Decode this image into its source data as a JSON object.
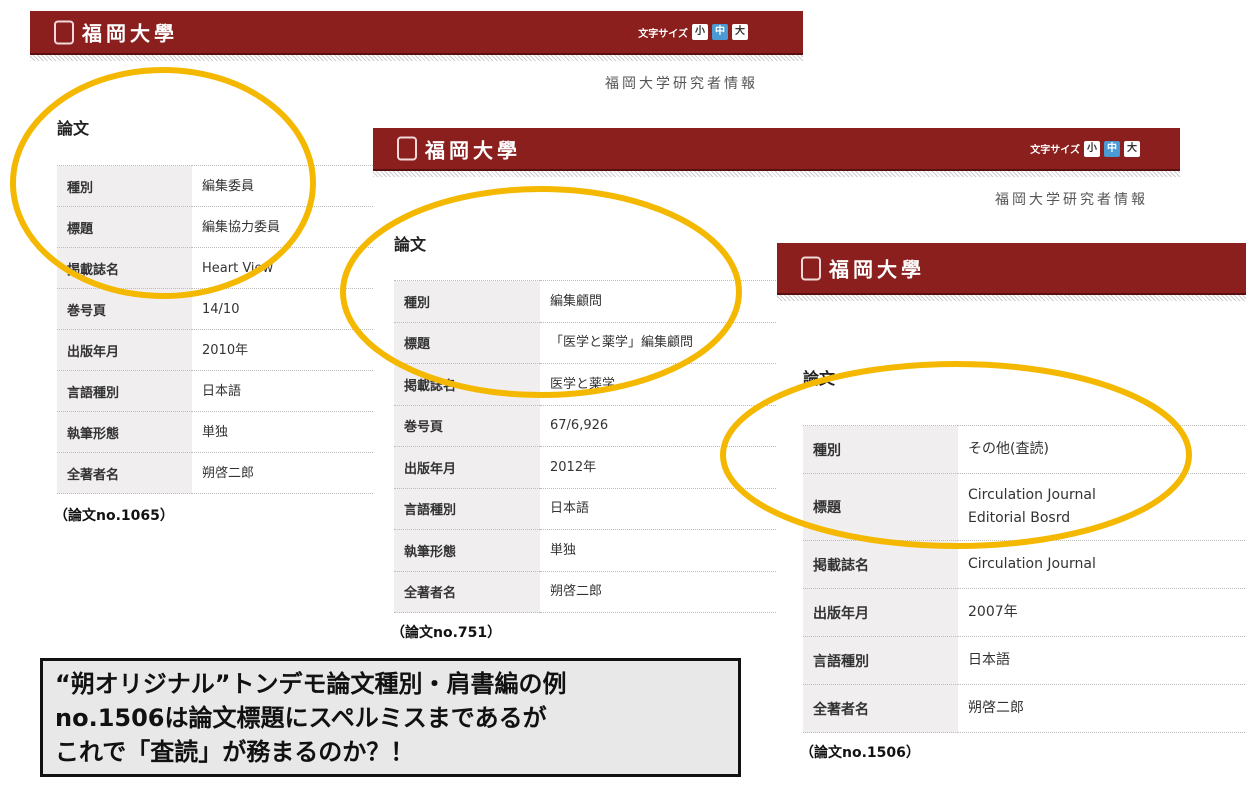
{
  "panels": [
    {
      "logo": "福岡大學",
      "font_size_label": "文字サイズ",
      "font_sizes": [
        "小",
        "中",
        "大"
      ],
      "site_title": "福岡大学研究者情報",
      "section": "論文",
      "rows": [
        [
          "種別",
          "編集委員"
        ],
        [
          "標題",
          "編集協力委員"
        ],
        [
          "掲載誌名",
          "Heart View"
        ],
        [
          "巻号頁",
          "14/10"
        ],
        [
          "出版年月",
          "2010年"
        ],
        [
          "言語種別",
          "日本語"
        ],
        [
          "執筆形態",
          "単独"
        ],
        [
          "全著者名",
          "朔啓二郎"
        ]
      ],
      "caption": "（論文no.1065）"
    },
    {
      "logo": "福岡大學",
      "font_size_label": "文字サイズ",
      "font_sizes": [
        "小",
        "中",
        "大"
      ],
      "site_title": "福岡大学研究者情報",
      "section": "論文",
      "rows": [
        [
          "種別",
          "編集顧問"
        ],
        [
          "標題",
          "「医学と薬学」編集顧問"
        ],
        [
          "掲載誌名",
          "医学と薬学"
        ],
        [
          "巻号頁",
          "67/6,926"
        ],
        [
          "出版年月",
          "2012年"
        ],
        [
          "言語種別",
          "日本語"
        ],
        [
          "執筆形態",
          "単独"
        ],
        [
          "全著者名",
          "朔啓二郎"
        ]
      ],
      "caption": "（論文no.751）"
    },
    {
      "logo": "福岡大學",
      "section": "論文",
      "rows": [
        [
          "種別",
          "その他(査読)"
        ],
        [
          "標題",
          "Circulation Journal\nEditorial Bosrd"
        ],
        [
          "掲載誌名",
          "Circulation Journal"
        ],
        [
          "出版年月",
          "2007年"
        ],
        [
          "言語種別",
          "日本語"
        ],
        [
          "全著者名",
          "朔啓二郎"
        ]
      ],
      "caption": "（論文no.1506）"
    }
  ],
  "note": "“朔オリジナル”トンデモ論文種別・肩書編の例\nno.1506は論文標題にスペルミスまであるが\nこれで「査読」が務まるのか？！",
  "colors": {
    "header": "#8a1f1e",
    "highlight": "#f5b800",
    "active_size": "#4a9ad6"
  }
}
